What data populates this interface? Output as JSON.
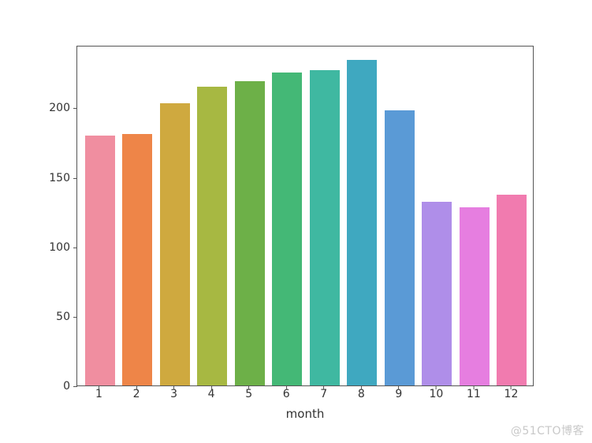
{
  "chart_data": {
    "type": "bar",
    "categories": [
      "1",
      "2",
      "3",
      "4",
      "5",
      "6",
      "7",
      "8",
      "9",
      "10",
      "11",
      "12"
    ],
    "values": [
      180,
      181,
      203,
      215,
      219,
      225,
      227,
      234,
      198,
      132,
      128,
      137
    ],
    "xlabel": "month",
    "ylabel": "",
    "title": "",
    "ylim": [
      0,
      245
    ],
    "y_ticks": [
      0,
      50,
      100,
      150,
      200
    ],
    "colors": [
      "#f08ea0",
      "#ee8548",
      "#cfa93f",
      "#a7b842",
      "#6db048",
      "#44b876",
      "#3fb8a1",
      "#3fa8c0",
      "#5a9ad6",
      "#af8ee9",
      "#e67ee0",
      "#f17baf"
    ]
  },
  "watermark": "@51CTO博客"
}
